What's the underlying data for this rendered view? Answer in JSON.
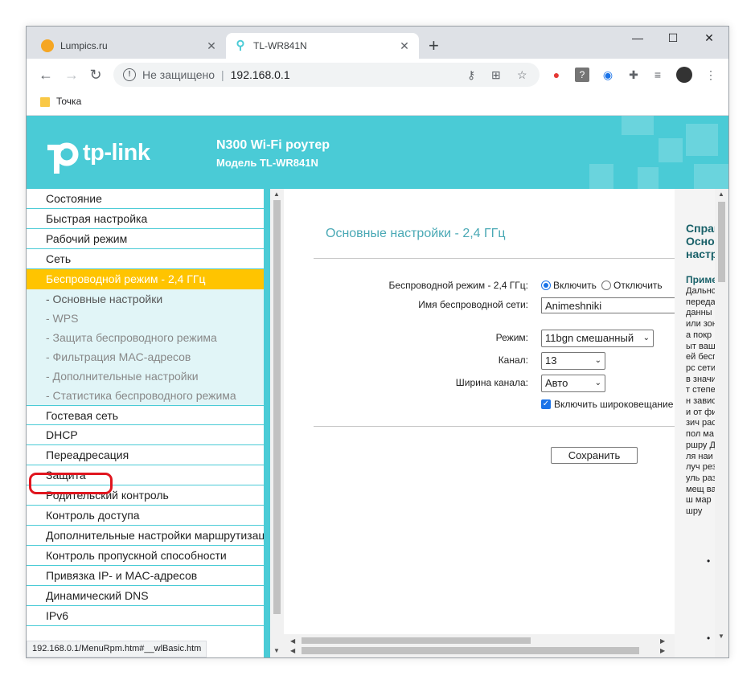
{
  "browser": {
    "tabs": [
      {
        "title": "Lumpics.ru",
        "close": "✕"
      },
      {
        "title": "TL-WR841N",
        "close": "✕"
      }
    ],
    "new_tab": "+",
    "window_controls": {
      "minimize": "—",
      "maximize": "☐",
      "close": "✕"
    },
    "address": {
      "security_text": "Не защищено",
      "separator": "|",
      "url": "192.168.0.1"
    },
    "bookmark": "Точка",
    "status_url": "192.168.0.1/MenuRpm.htm#__wlBasic.htm"
  },
  "header": {
    "logo": "tp-link",
    "title": "N300 Wi-Fi роутер",
    "model": "Модель TL-WR841N"
  },
  "menu": {
    "top": [
      "Состояние",
      "Быстрая настройка",
      "Рабочий режим",
      "Сеть"
    ],
    "active": "Беспроводной режим - 2,4 ГГц",
    "sub": [
      "- Основные настройки",
      "- WPS",
      "- Защита беспроводного режима",
      "- Фильтрация MAC-адресов",
      "- Дополнительные настройки",
      "- Статистика беспроводного режима"
    ],
    "bottom": [
      "Гостевая сеть",
      "DHCP",
      "Переадресация",
      "Защита",
      "Родительский контроль",
      "Контроль доступа",
      "Дополнительные настройки маршрутизации",
      "Контроль пропускной способности",
      "Привязка IP- и MAC-адресов",
      "Динамический DNS",
      "IPv6"
    ]
  },
  "content": {
    "title": "Основные настройки - 2,4 ГГц",
    "wireless_label": "Беспроводной режим - 2,4 ГГц:",
    "enable_label": "Включить",
    "disable_label": "Отключить",
    "ssid_label": "Имя беспроводной сети:",
    "ssid_value": "Animeshniki",
    "mode_label": "Режим:",
    "mode_value": "11bgn смешанный",
    "channel_label": "Канал:",
    "channel_value": "13",
    "width_label": "Ширина канала:",
    "width_value": "Авто",
    "broadcast_label": "Включить широковещание",
    "save_label": "Сохранить"
  },
  "help": {
    "title": "Справ Основ настр",
    "subtitle": "Приме",
    "body": "Дальнс переда данны или зона покрыт вашей беспрс сети в значит степен зависи от физич распол маршру Для наилуч резуль размещ ваш маршру"
  }
}
